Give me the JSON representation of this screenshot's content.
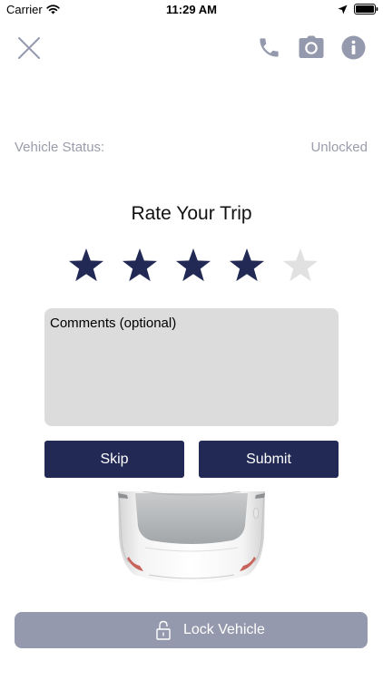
{
  "status_bar": {
    "carrier": "Carrier",
    "time": "11:29 AM"
  },
  "toolbar": {
    "icons": [
      "close-icon",
      "phone-icon",
      "camera-icon",
      "info-icon"
    ],
    "icon_color": "#9599ad"
  },
  "vehicle_status": {
    "label": "Vehicle Status:",
    "value": "Unlocked"
  },
  "rating": {
    "title": "Rate Your Trip",
    "selected": 4,
    "max": 5,
    "filled_color": "#212954",
    "empty_color": "#e1e1e1"
  },
  "comments": {
    "placeholder": "Comments (optional)",
    "value": ""
  },
  "buttons": {
    "skip_label": "Skip",
    "submit_label": "Submit",
    "color": "#212954"
  },
  "lock": {
    "label": "Lock Vehicle",
    "color": "#9599ad"
  }
}
